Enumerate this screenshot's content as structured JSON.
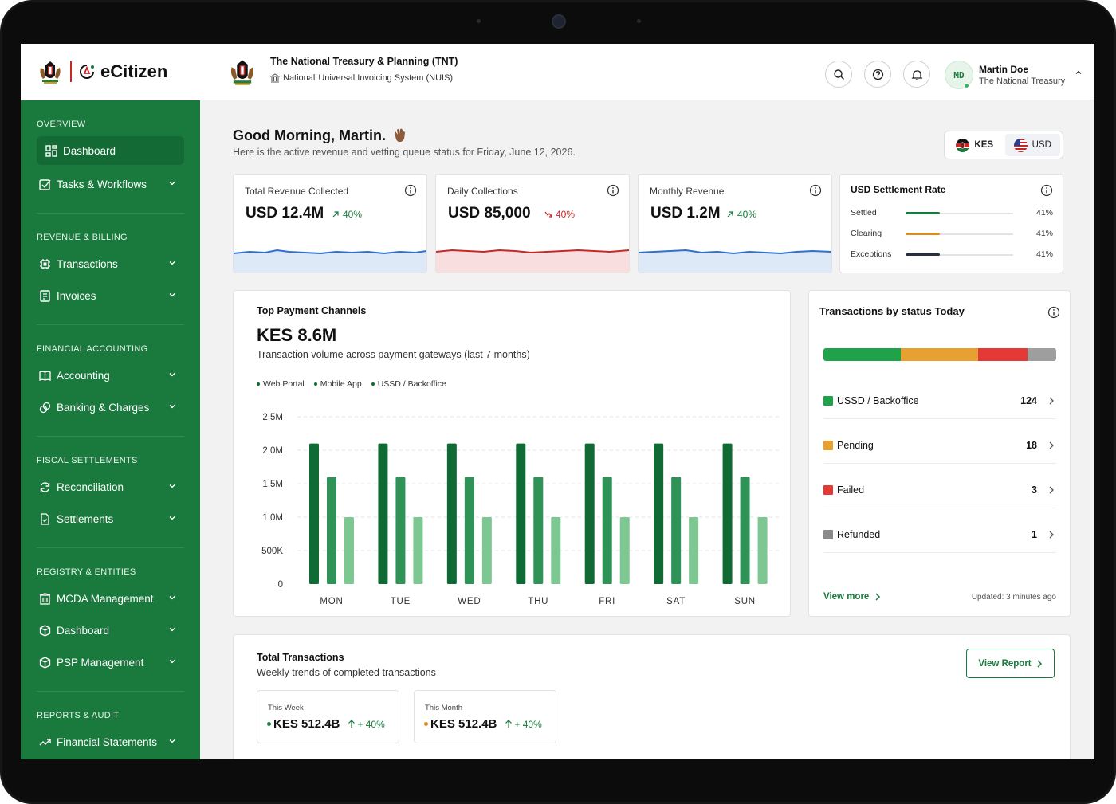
{
  "brand": {
    "name": "eCitizen"
  },
  "sidebar": {
    "sections": [
      {
        "title": "OVERVIEW",
        "items": [
          {
            "label": "Dashboard",
            "icon": "grid-icon",
            "active": true
          }
        ]
      },
      {
        "title": "",
        "items": [
          {
            "label": "Tasks & Workflows",
            "icon": "checkbox-icon"
          }
        ]
      },
      {
        "title": "REVENUE & BILLING",
        "items": [
          {
            "label": "Transactions",
            "icon": "chip-icon"
          },
          {
            "label": "Invoices",
            "icon": "receipt-icon"
          }
        ]
      },
      {
        "title": "FINANCIAL ACCOUNTING",
        "items": [
          {
            "label": "Accounting",
            "icon": "book-icon"
          },
          {
            "label": "Banking & Charges",
            "icon": "coins-icon"
          }
        ]
      },
      {
        "title": "FISCAL SETTLEMENTS",
        "items": [
          {
            "label": "Reconciliation",
            "icon": "refresh-icon"
          },
          {
            "label": "Settlements",
            "icon": "document-icon"
          }
        ]
      },
      {
        "title": "REGISTRY & ENTITIES",
        "items": [
          {
            "label": "MCDA Management",
            "icon": "building-icon"
          },
          {
            "label": "Dashboard",
            "icon": "cube-icon"
          },
          {
            "label": "PSP Management",
            "icon": "cube-icon"
          }
        ]
      },
      {
        "title": "REPORTS & AUDIT",
        "items": [
          {
            "label": "Financial Statements",
            "icon": "trend-icon"
          }
        ]
      }
    ]
  },
  "header": {
    "org_title": "The National Treasury & Planning (TNT)",
    "org_sub_1": "National",
    "org_sub_2": "Universal Invoicing System (NUIS)",
    "user": {
      "initials": "MD",
      "name": "Martin Doe",
      "org": "The National Treasury"
    }
  },
  "greeting": {
    "title": "Good Morning, Martin.",
    "subtitle": "Here is the active revenue and vetting queue status for Friday, June 12, 2026."
  },
  "currency": {
    "options": [
      "KES",
      "USD"
    ],
    "selected": "KES"
  },
  "kpis": [
    {
      "title": "Total Revenue Collected",
      "value": "USD 12.4M",
      "delta": "40%",
      "direction": "up",
      "color": "#1a7a3d",
      "spark_color": "#2f6fcf",
      "spark_fill": "#dde9f7"
    },
    {
      "title": "Daily Collections",
      "value": "USD 85,000",
      "delta": "40%",
      "direction": "down",
      "color": "#c62828",
      "spark_color": "#c62828",
      "spark_fill": "#f8dede"
    },
    {
      "title": "Monthly Revenue",
      "value": "USD 1.2M",
      "delta": "40%",
      "direction": "up",
      "color": "#1a7a3d",
      "spark_color": "#2f6fcf",
      "spark_fill": "#dde9f7"
    }
  ],
  "settlement": {
    "title": "USD Settlement Rate",
    "rows": [
      {
        "label": "Settled",
        "pct": "41%",
        "value": 0.32,
        "color": "#1a7a3d"
      },
      {
        "label": "Clearing",
        "pct": "41%",
        "value": 0.32,
        "color": "#d98c1f"
      },
      {
        "label": "Exceptions",
        "pct": "41%",
        "value": 0.32,
        "color": "#253042"
      }
    ]
  },
  "payment_channels": {
    "title": "Top Payment Channels",
    "total": "KES 8.6M",
    "subtitle": "Transaction volume across payment gateways (last 7 months)"
  },
  "chart_data": {
    "type": "bar",
    "categories": [
      "MON",
      "TUE",
      "WED",
      "THU",
      "FRI",
      "SAT",
      "SUN"
    ],
    "series": [
      {
        "name": "Web Portal",
        "values": [
          2100000,
          2100000,
          2100000,
          2100000,
          2100000,
          2100000,
          2100000
        ],
        "color": "#0f6b33"
      },
      {
        "name": "Mobile App",
        "values": [
          1600000,
          1600000,
          1600000,
          1600000,
          1600000,
          1600000,
          1600000
        ],
        "color": "#2f9358"
      },
      {
        "name": "USSD / Backoffice",
        "values": [
          1000000,
          1000000,
          1000000,
          1000000,
          1000000,
          1000000,
          1000000
        ],
        "color": "#7cc792"
      }
    ],
    "y_ticks": [
      "0",
      "500K",
      "1.0M",
      "1.5M",
      "2.0M",
      "2.5M"
    ],
    "ylim": [
      0,
      2500000
    ],
    "grid": true,
    "legend": "top-left"
  },
  "status_today": {
    "title": "Transactions by status Today",
    "bar": [
      {
        "color": "#1fa34a",
        "fraction": 0.333
      },
      {
        "color": "#e8a030",
        "fraction": 0.333
      },
      {
        "color": "#e53935",
        "fraction": 0.212
      },
      {
        "color": "#9e9e9e",
        "fraction": 0.122
      }
    ],
    "rows": [
      {
        "label": "USSD / Backoffice",
        "count": "124",
        "color": "#1fa34a"
      },
      {
        "label": "Pending",
        "count": "18",
        "color": "#e8a030"
      },
      {
        "label": "Failed",
        "count": "3",
        "color": "#e53935"
      },
      {
        "label": "Refunded",
        "count": "1",
        "color": "#8a8a8a"
      }
    ],
    "view_more": "View more",
    "updated": "Updated: 3 minutes ago"
  },
  "total_transactions": {
    "title": "Total Transactions",
    "subtitle": "Weekly trends of completed transactions",
    "button": "View Report",
    "cards": [
      {
        "label": "This Week",
        "value": "KES 512.4B",
        "delta": "+ 40%",
        "dot_color": "#1a7a3d"
      },
      {
        "label": "This Month",
        "value": "KES 512.4B",
        "delta": "+ 40%",
        "dot_color": "#d98c1f"
      }
    ]
  }
}
